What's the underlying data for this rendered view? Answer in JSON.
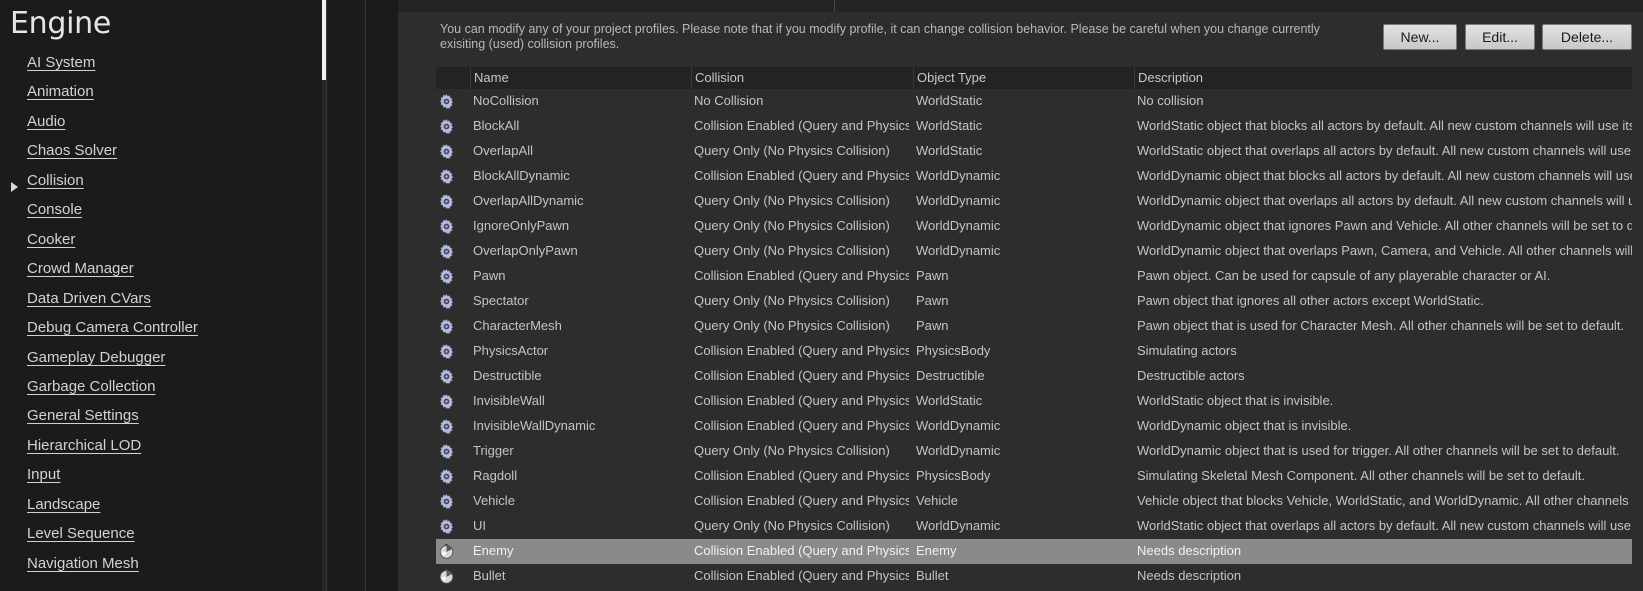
{
  "sidebar": {
    "title": "Engine",
    "items": [
      {
        "label": "AI System"
      },
      {
        "label": "Animation"
      },
      {
        "label": "Audio"
      },
      {
        "label": "Chaos Solver"
      },
      {
        "label": "Collision"
      },
      {
        "label": "Console"
      },
      {
        "label": "Cooker"
      },
      {
        "label": "Crowd Manager"
      },
      {
        "label": "Data Driven CVars"
      },
      {
        "label": "Debug Camera Controller"
      },
      {
        "label": "Gameplay Debugger"
      },
      {
        "label": "Garbage Collection"
      },
      {
        "label": "General Settings"
      },
      {
        "label": "Hierarchical LOD"
      },
      {
        "label": "Input"
      },
      {
        "label": "Landscape"
      },
      {
        "label": "Level Sequence"
      },
      {
        "label": "Navigation Mesh"
      }
    ]
  },
  "main": {
    "description": "You can modify any of your project profiles. Please note that if you modify profile, it can change collision behavior. Please be careful when you change currently exisiting (used) collision profiles.",
    "buttons": {
      "new": "New...",
      "edit": "Edit...",
      "delete": "Delete..."
    },
    "table": {
      "headers": {
        "name": "Name",
        "collision": "Collision",
        "object_type": "Object Type",
        "description": "Description"
      },
      "rows": [
        {
          "icon": "gear-icon",
          "name": "NoCollision",
          "collision": "No Collision",
          "object_type": "WorldStatic",
          "description": "No collision"
        },
        {
          "icon": "gear-icon",
          "name": "BlockAll",
          "collision": "Collision Enabled (Query and Physics)",
          "object_type": "WorldStatic",
          "description": "WorldStatic object that blocks all actors by default. All new custom channels will use its own default response."
        },
        {
          "icon": "gear-icon",
          "name": "OverlapAll",
          "collision": "Query Only (No Physics Collision)",
          "object_type": "WorldStatic",
          "description": "WorldStatic object that overlaps all actors by default. All new custom channels will use its own default response."
        },
        {
          "icon": "gear-icon",
          "name": "BlockAllDynamic",
          "collision": "Collision Enabled (Query and Physics)",
          "object_type": "WorldDynamic",
          "description": "WorldDynamic object that blocks all actors by default. All new custom channels will use its own default response."
        },
        {
          "icon": "gear-icon",
          "name": "OverlapAllDynamic",
          "collision": "Query Only (No Physics Collision)",
          "object_type": "WorldDynamic",
          "description": "WorldDynamic object that overlaps all actors by default. All new custom channels will use its own default response."
        },
        {
          "icon": "gear-icon",
          "name": "IgnoreOnlyPawn",
          "collision": "Query Only (No Physics Collision)",
          "object_type": "WorldDynamic",
          "description": "WorldDynamic object that ignores Pawn and Vehicle. All other channels will be set to default."
        },
        {
          "icon": "gear-icon",
          "name": "OverlapOnlyPawn",
          "collision": "Query Only (No Physics Collision)",
          "object_type": "WorldDynamic",
          "description": "WorldDynamic object that overlaps Pawn, Camera, and Vehicle. All other channels will be set to default."
        },
        {
          "icon": "gear-icon",
          "name": "Pawn",
          "collision": "Collision Enabled (Query and Physics)",
          "object_type": "Pawn",
          "description": "Pawn object. Can be used for capsule of any playerable character or AI."
        },
        {
          "icon": "gear-icon",
          "name": "Spectator",
          "collision": "Query Only (No Physics Collision)",
          "object_type": "Pawn",
          "description": "Pawn object that ignores all other actors except WorldStatic."
        },
        {
          "icon": "gear-icon",
          "name": "CharacterMesh",
          "collision": "Query Only (No Physics Collision)",
          "object_type": "Pawn",
          "description": "Pawn object that is used for Character Mesh. All other channels will be set to default."
        },
        {
          "icon": "gear-icon",
          "name": "PhysicsActor",
          "collision": "Collision Enabled (Query and Physics)",
          "object_type": "PhysicsBody",
          "description": "Simulating actors"
        },
        {
          "icon": "gear-icon",
          "name": "Destructible",
          "collision": "Collision Enabled (Query and Physics)",
          "object_type": "Destructible",
          "description": "Destructible actors"
        },
        {
          "icon": "gear-icon",
          "name": "InvisibleWall",
          "collision": "Collision Enabled (Query and Physics)",
          "object_type": "WorldStatic",
          "description": "WorldStatic object that is invisible."
        },
        {
          "icon": "gear-icon",
          "name": "InvisibleWallDynamic",
          "collision": "Collision Enabled (Query and Physics)",
          "object_type": "WorldDynamic",
          "description": "WorldDynamic object that is invisible."
        },
        {
          "icon": "gear-icon",
          "name": "Trigger",
          "collision": "Query Only (No Physics Collision)",
          "object_type": "WorldDynamic",
          "description": "WorldDynamic object that is used for trigger. All other channels will be set to default."
        },
        {
          "icon": "gear-icon",
          "name": "Ragdoll",
          "collision": "Collision Enabled (Query and Physics)",
          "object_type": "PhysicsBody",
          "description": "Simulating Skeletal Mesh Component. All other channels will be set to default."
        },
        {
          "icon": "gear-icon",
          "name": "Vehicle",
          "collision": "Collision Enabled (Query and Physics)",
          "object_type": "Vehicle",
          "description": "Vehicle object that blocks Vehicle, WorldStatic, and WorldDynamic. All other channels will be set to default."
        },
        {
          "icon": "gear-icon",
          "name": "UI",
          "collision": "Query Only (No Physics Collision)",
          "object_type": "WorldDynamic",
          "description": "WorldStatic object that overlaps all actors by default. All new custom channels will use its own default response."
        },
        {
          "icon": "custom-profile-icon",
          "name": "Enemy",
          "collision": "Collision Enabled (Query and Physics)",
          "object_type": "Enemy",
          "description": "Needs description",
          "selected": true
        },
        {
          "icon": "custom-profile-icon",
          "name": "Bullet",
          "collision": "Collision Enabled (Query and Physics)",
          "object_type": "Bullet",
          "description": "Needs description"
        }
      ]
    }
  }
}
